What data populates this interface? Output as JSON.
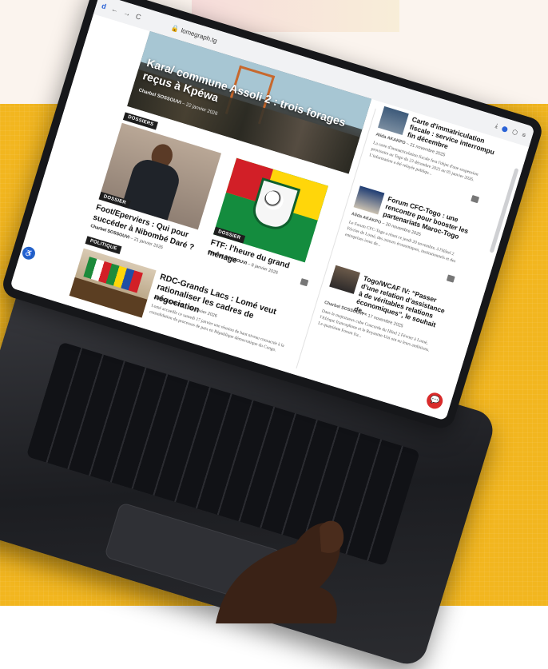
{
  "browser": {
    "logo": "d",
    "nav_back": "←",
    "nav_forward": "→",
    "nav_reload": "C",
    "url": "lomegraph.tg",
    "icons": [
      "download-icon",
      "profile-icon",
      "extensions-icon",
      "menu-icon"
    ]
  },
  "hero": {
    "title": "Kara/ commune Assoli 2 : trois forages reçus à Kpéwa",
    "author": "Charbel SOSSOUVI",
    "date": "22 janvier 2026"
  },
  "sections": {
    "dossiers": "DOSSIERS",
    "politique": "POLITIQUE",
    "dossier_badge": "DOSSIER"
  },
  "cards": {
    "eperviers": {
      "title": "Foot/Eperviers : Qui pour succéder à Nibombé Daré ?",
      "author": "Charbel SOSSOUVI",
      "date": "21 janvier 2026",
      "badge": "DOSSIER"
    },
    "ftf": {
      "title": "FTF: l’heure du grand ménage",
      "author": "Charbel SOSSOUVI",
      "date": "8 janvier 2026",
      "badge": "DOSSIER"
    },
    "rdc": {
      "title": "RDC-Grands Lacs : Lomé veut rationaliser les cadres de négociation",
      "author": "Alida AKAKPO",
      "date": "18 janvier 2026",
      "excerpt": "Lomé accueille ce samedi 17 janvier une réunion de haut niveau consacrée à la consolidation du processus de paix en République démocratique du Congo."
    }
  },
  "sidebar": {
    "items": [
      {
        "title": "Carte d'immatriculation fiscale : service interrompu fin décembre",
        "author": "Alida AKAKPO",
        "date": "21 novembre 2025",
        "excerpt": "La carte d'immatriculation fiscale fera l'objet d'une suspension provisoire au Togo du 23 décembre 2025 au 05 janvier 2026. L'information a été relayée publiqu..."
      },
      {
        "title": "Forum CFC-Togo : une rencontre pour booster les partenariats Maroc-Togo",
        "author": "Alida AKAKPO",
        "date": "20 novembre 2025",
        "excerpt": "Le Forum CFC-Togo a réuni ce jeudi 20 novembre, à l'Hôtel 2 Février de Lomé, des acteurs économiques, institutionnels et des entreprises issus de..."
      },
      {
        "title": "Togo/WCAF IV: “Passer d’une relation d’assistance à de véritables relations économiques”, le souhait de...",
        "author": "Charbel SOSSOUVI",
        "date": "17 novembre 2025",
        "excerpt": "Dans le majestueux cube Concorde du Hôtel 2 Février à Lomé, l'Afrique francophone et le Royaume-Uni ont eu leurs ambitions. Le quatrième Forum fra..."
      }
    ]
  },
  "comment_glyph": "💬",
  "colors": {
    "background_yellow": "#f2b61f",
    "tag_black": "#1e1e1e",
    "chat_red": "#d92b2b",
    "accessibility_blue": "#2663c9"
  }
}
